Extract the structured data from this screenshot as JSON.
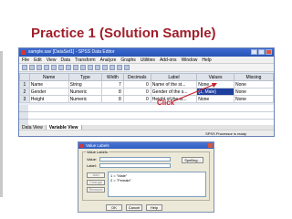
{
  "slide": {
    "title": "Practice 1 (Solution Sample)"
  },
  "spss": {
    "window_title": "sample.sav [DataSet1] - SPSS Data Editor",
    "menu": [
      "File",
      "Edit",
      "View",
      "Data",
      "Transform",
      "Analyze",
      "Graphs",
      "Utilities",
      "Add-ons",
      "Window",
      "Help"
    ],
    "columns": [
      "",
      "Name",
      "Type",
      "Width",
      "Decimals",
      "Label",
      "Values",
      "Missing"
    ],
    "rows": [
      {
        "num": "1",
        "name": "Name",
        "type": "String",
        "width": "7",
        "decimals": "0",
        "label": "Name of the st...",
        "values": "None",
        "missing": "None"
      },
      {
        "num": "2",
        "name": "Gender",
        "type": "Numeric",
        "width": "8",
        "decimals": "0",
        "label": "Gender of the s...",
        "values": "{1, Male}",
        "missing": "None"
      },
      {
        "num": "3",
        "name": "Height",
        "type": "Numeric",
        "width": "8",
        "decimals": "0",
        "label": "Height of the st...",
        "values": "None",
        "missing": "None"
      }
    ],
    "tabs": [
      "Data View",
      "Variable View"
    ],
    "status": "SPSS Processor is ready"
  },
  "annotation": {
    "click": "Click"
  },
  "dialog": {
    "title": "Value Labels",
    "group_label": "Value Labels",
    "value_label": "Value:",
    "label_label": "Label:",
    "spelling": "Spelling...",
    "add": "Add",
    "change": "Change",
    "remove": "Remove",
    "list": [
      "1 = \"Male\"",
      "2 = \"Female\""
    ],
    "ok": "OK",
    "cancel": "Cancel",
    "help": "Help"
  },
  "colors": {
    "title": "#a01e2a",
    "click": "#c8202c",
    "selected_cell": "#1f3f9f"
  }
}
